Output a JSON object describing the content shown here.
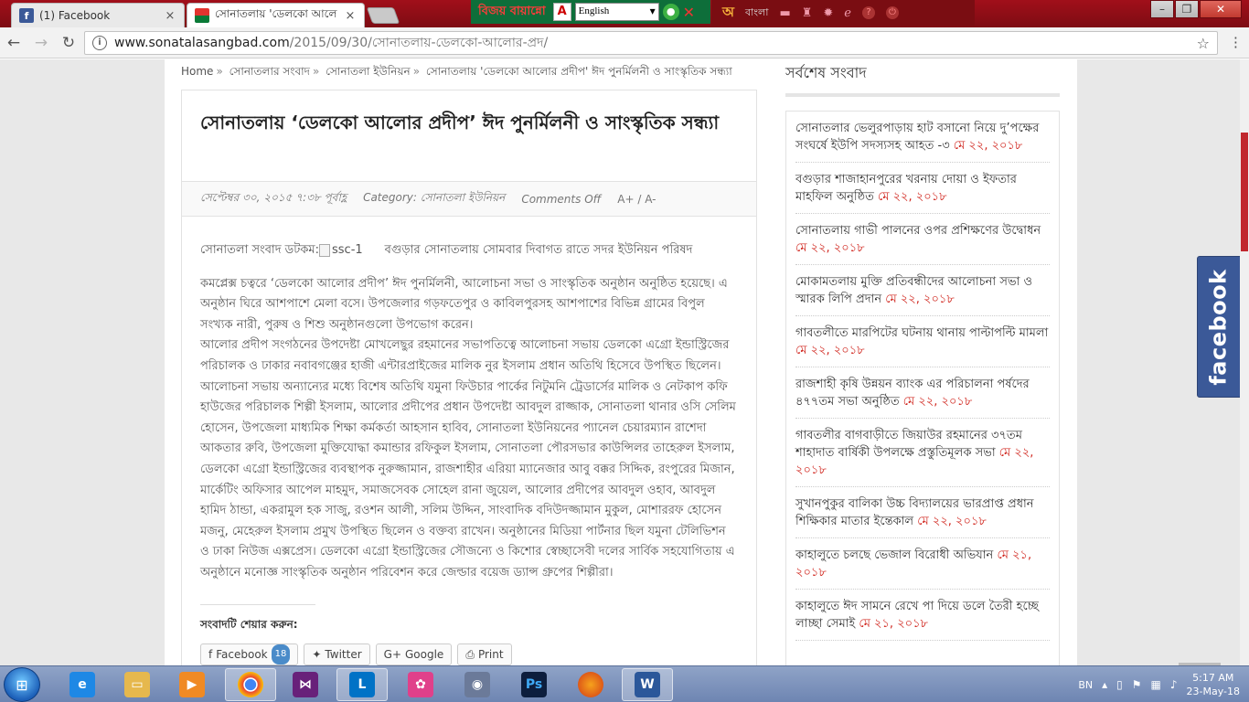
{
  "browser": {
    "tabs": [
      {
        "label": "(1) Facebook",
        "close": "×"
      },
      {
        "label": "সোনাতলায় 'ডেলকো আলে",
        "close": "×"
      }
    ],
    "url_host": "www.sonatalasangbad.com",
    "url_path": "/2015/09/30/সোনাতলায়-ডেলকো-আলোর-প্রদ/"
  },
  "bijoy_toolbar": {
    "brand": "বিজয় বায়ান্নো",
    "language": "English"
  },
  "avro_toolbar": {
    "logo": "অ",
    "language": "বাংলা"
  },
  "breadcrumb": [
    "Home",
    "সোনাতলার সংবাদ",
    "সোনাতলা ইউনিয়ন",
    "সোনাতলায় 'ডেলকো আলোর প্রদীপ' ঈদ পুনর্মিলনী ও সাংস্কৃতিক সন্ধ্যা"
  ],
  "article": {
    "title": "সোনাতলায় ‘ডেলকো আলোর প্রদীপ’ ঈদ পুনর্মিলনী ও সাংস্কৃতিক সন্ধ্যা",
    "date": "সেপ্টেম্বর ৩০, ২০১৫ ৭:৩৮ পূর্বাহ্ণ",
    "category": "Category: সোনাতলা ইউনিয়ন",
    "comments": "Comments Off",
    "font_size": "A+ / A-",
    "lead_prefix": "সোনাতলা সংবাদ ডটকম:",
    "image_alt": "ssc-1",
    "lead_text": "বগুড়ার সোনাতলায় সোমবার দিবাগত রাতে সদর ইউনিয়ন পরিষদ",
    "paragraph1": "কমপ্লেক্স চত্বরে ‘ডেলকো আলোর প্রদীপ’ ঈদ পুনর্মিলনী, আলোচনা সভা ও সাংস্কৃতিক অনুষ্ঠান অনুষ্ঠিত হয়েছে। এ অনুষ্ঠান ঘিরে আশপাশে মেলা বসে। উপজেলার গড়ফতেপুর ও কাবিলপুরসহ আশপাশের বিভিন্ন গ্রামের বিপুল সংখ্যক নারী, পুরুষ ও শিশু অনুষ্ঠানগুলো উপভোগ করেন।",
    "paragraph2": "আলোর প্রদীপ সংগঠনের উপদেষ্টা মোখলেছুর রহমানের সভাপতিত্বে আলোচনা সভায় ডেলকো এগ্রো ইন্ডাস্ট্রিজের পরিচালক ও ঢাকার নবাবগঞ্জের হাজী এন্টারপ্রাইজের মালিক নুর ইসলাম প্রধান অতিথি হিসেবে উপস্থিত ছিলেন। আলোচনা সভায় অন্যান্যের মধ্যে বিশেষ অতিথি যমুনা ফিউচার পার্কের নিটুমনি ট্রেডার্সের মালিক ও নেটকাপ কফি হাউজের পরিচালক শিল্পী ইসলাম, আলোর প্রদীপের প্রধান উপদেষ্টা আবদুল রাজ্জাক, সোনাতলা থানার ওসি সেলিম হোসেন, উপজেলা মাধ্যমিক শিক্ষা কর্মকর্তা আহসান হাবিব, সোনাতলা ইউনিয়নের প্যানেল চেয়ারম্যান রাশেদা আকতার রুবি, উপজেলা মুক্তিযোদ্ধা কমান্ডার রফিকুল ইসলাম, সোনাতলা পৌরসভার কাউন্সিলর তাহেরুল ইসলাম, ডেলকো এগ্রো ইন্ডাস্ট্রিজের ব্যবস্থাপক নুরুজ্জামান, রাজশাহীর এরিয়া ম্যানেজার আবু বক্কর সিদ্দিক, রংপুরের মিজান, মার্কেটিং অফিসার আপেল মাহমুদ, সমাজসেবক সোহেল রানা জুয়েল, আলোর প্রদীপের আবদুল ওহাব, আবদুল হামিদ ঠান্ডা, একরামুল হক সাজু, রওশন আলী, সলিম উদ্দিন, সাংবাদিক বদিউদজ্জামান মুকুল, মোশাররফ হোসেন মজনু, মেহেরুল ইসলাম প্রমুখ উপস্থিত ছিলেন ও বক্তব্য রাখেন। অনুষ্ঠানের মিডিয়া পার্টনার ছিল যমুনা টেলিভিশন ও ঢাকা নিউজ এক্সপ্রেস। ডেলকো এগ্রো ইন্ডাস্ট্রিজের সৌজন্যে ও কিশোর স্বেচ্ছাসেবী দলের সার্বিক সহযোগিতায় এ অনুষ্ঠানে মনোজ্ঞ সাংস্কৃতিক অনুষ্ঠান পরিবেশন করে জেল্ডার বয়েজ ড্যান্স গ্রুপের শিল্পীরা।",
    "share_title": "সংবাদটি শেয়ার করুন:",
    "share_buttons": [
      {
        "label": "Facebook",
        "count": "18"
      },
      {
        "label": "Twitter"
      },
      {
        "label": "Google"
      },
      {
        "label": "Print"
      }
    ]
  },
  "sidebar": {
    "title": "সর্বশেষ সংবাদ",
    "items": [
      {
        "text": "সোনাতলার ভেলুরপাড়ায় হাট বসানো নিয়ে দু’পক্ষের সংঘর্ষে ইউপি সদস্যসহ আহত -৩",
        "date": "মে ২২, ২০১৮"
      },
      {
        "text": "বগুড়ার শাজাহানপুরের খরনায় দোয়া ও ইফতার মাহফিল অনুষ্ঠিত",
        "date": "মে ২২, ২০১৮"
      },
      {
        "text": "সোনাতলায় গাভী পালনের ওপর প্রশিক্ষণের উদ্বোধন",
        "date": "মে ২২, ২০১৮"
      },
      {
        "text": "মোকামতলায় মুক্তি প্রতিবন্ধীদের আলোচনা সভা ও স্মারক লিপি প্রদান",
        "date": "মে ২২, ২০১৮"
      },
      {
        "text": "গাবতলীতে মারপিটের ঘটনায় থানায় পাল্টাপল্টি মামলা",
        "date": "মে ২২, ২০১৮"
      },
      {
        "text": "রাজশাহী কৃষি উন্নয়ন ব্যাংক এর পরিচালনা পর্ষদের ৪৭৭তম সভা অনুষ্ঠিত",
        "date": "মে ২২, ২০১৮"
      },
      {
        "text": "গাবতলীর বাগবাড়ীতে জিয়াউর রহমানের ৩৭তম শাহাদাত বার্ষিকী উপলক্ষে প্রস্তুতিমূলক সভা",
        "date": "মে ২২, ২০১৮"
      },
      {
        "text": "সুখানপুকুর বালিকা উচ্চ বিদ্যালয়ের ভারপ্রাপ্ত প্রধান শিক্ষিকার মাতার ইন্তেকাল",
        "date": "মে ২২, ২০১৮"
      },
      {
        "text": "কাহালুতে চলছে ভেজাল বিরোধী অভিযান",
        "date": "মে ২১, ২০১৮"
      },
      {
        "text": "কাহালুতে ঈদ সামনে রেখে পা দিয়ে ডলে তৈরী হচ্ছে লাচ্ছা সেমাই",
        "date": "মে ২১, ২০১৮"
      }
    ]
  },
  "fb_widget": {
    "label": "facebook"
  },
  "taskbar": {
    "language": "BN",
    "time": "5:17 AM",
    "date": "23-May-18"
  }
}
